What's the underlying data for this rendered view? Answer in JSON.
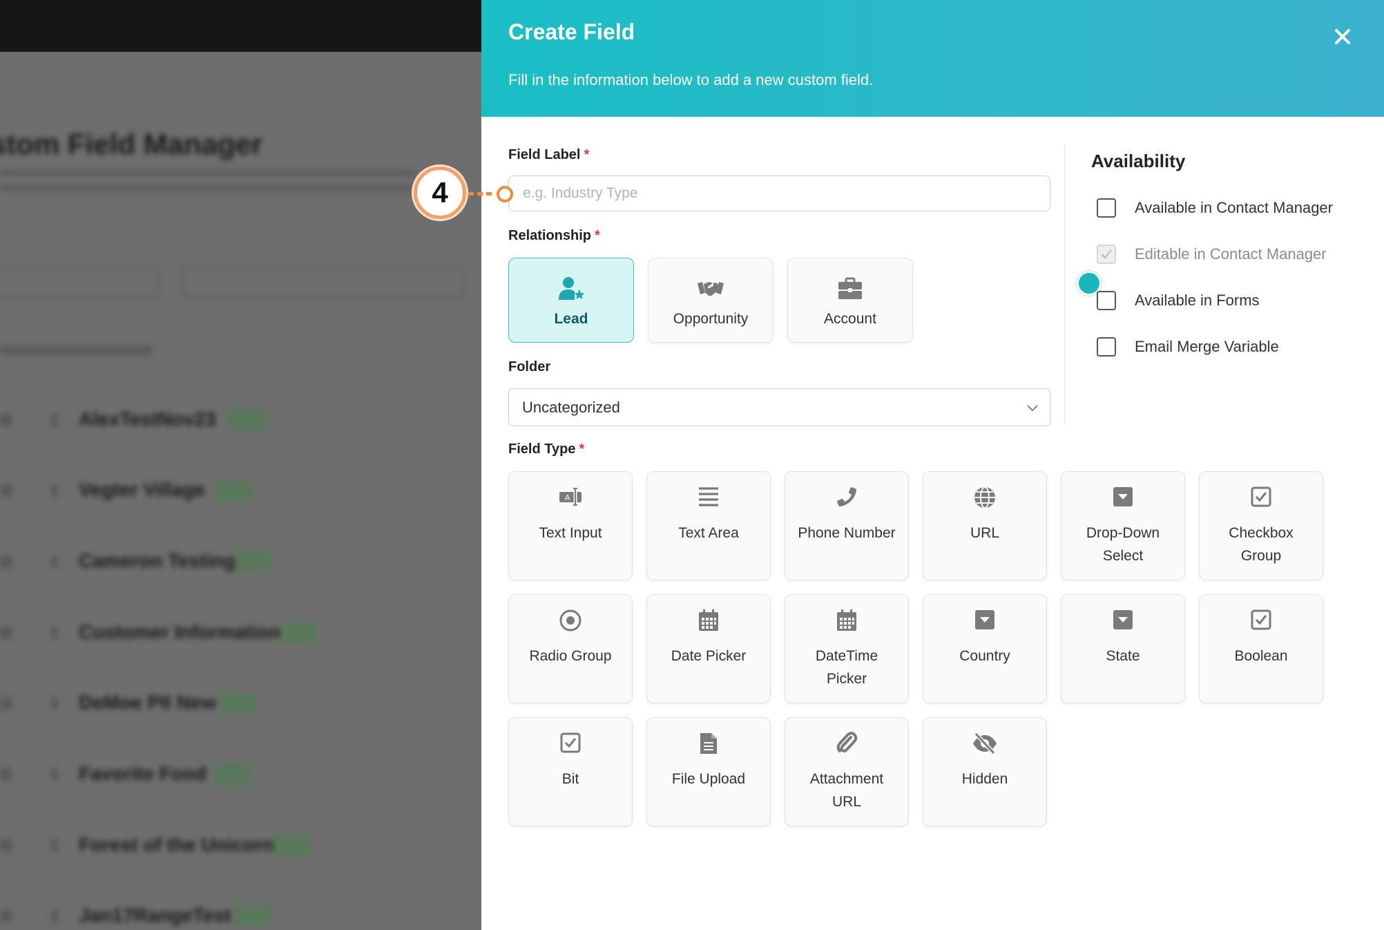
{
  "background": {
    "title": "stom Field Manager",
    "rows": [
      {
        "name": "AlexTestNov23"
      },
      {
        "name": "Vegter Village"
      },
      {
        "name": "Cameron Testing"
      },
      {
        "name": "Customer Information"
      },
      {
        "name": "DeMoe PII New"
      },
      {
        "name": "Favorite Food"
      },
      {
        "name": "Forest of the Unicorn"
      },
      {
        "name": "Jan17RangeTest"
      }
    ]
  },
  "panel": {
    "title": "Create Field",
    "subtitle": "Fill in the information below to add a new custom field.",
    "close_icon": "close-icon",
    "accent_color": "#1ab6bb"
  },
  "field_label": {
    "label": "Field Label",
    "required_mark": "*",
    "placeholder": "e.g. Industry Type",
    "value": ""
  },
  "relationship": {
    "label": "Relationship",
    "required_mark": "*",
    "selected": "Lead",
    "options": [
      {
        "label": "Lead",
        "icon": "user-star-icon"
      },
      {
        "label": "Opportunity",
        "icon": "handshake-icon"
      },
      {
        "label": "Account",
        "icon": "briefcase-icon"
      }
    ]
  },
  "folder": {
    "label": "Folder",
    "value": "Uncategorized",
    "icon": "chevron-down-icon"
  },
  "availability": {
    "title": "Availability",
    "options": [
      {
        "label": "Available in Contact Manager",
        "checked": false,
        "disabled": false
      },
      {
        "label": "Editable in Contact Manager",
        "checked": true,
        "disabled": true
      },
      {
        "label": "Available in Forms",
        "checked": false,
        "disabled": false
      },
      {
        "label": "Email Merge Variable",
        "checked": false,
        "disabled": false
      }
    ]
  },
  "field_type": {
    "label": "Field Type",
    "required_mark": "*",
    "types": [
      {
        "line1": "Text Input",
        "line2": "",
        "icon": "text-input-icon"
      },
      {
        "line1": "Text Area",
        "line2": "",
        "icon": "text-area-icon"
      },
      {
        "line1": "Phone Number",
        "line2": "",
        "icon": "phone-icon"
      },
      {
        "line1": "URL",
        "line2": "",
        "icon": "globe-icon"
      },
      {
        "line1": "Drop-Down",
        "line2": "Select",
        "icon": "dropdown-icon"
      },
      {
        "line1": "Checkbox",
        "line2": "Group",
        "icon": "checkbox-icon"
      },
      {
        "line1": "Radio Group",
        "line2": "",
        "icon": "radio-icon"
      },
      {
        "line1": "Date Picker",
        "line2": "",
        "icon": "calendar-icon"
      },
      {
        "line1": "DateTime",
        "line2": "Picker",
        "icon": "calendar-icon"
      },
      {
        "line1": "Country",
        "line2": "",
        "icon": "dropdown-icon"
      },
      {
        "line1": "State",
        "line2": "",
        "icon": "dropdown-icon"
      },
      {
        "line1": "Boolean",
        "line2": "",
        "icon": "checkbox-icon"
      },
      {
        "line1": "Bit",
        "line2": "",
        "icon": "checkbox-icon"
      },
      {
        "line1": "File Upload",
        "line2": "",
        "icon": "file-icon"
      },
      {
        "line1": "Attachment",
        "line2": "URL",
        "icon": "paperclip-icon"
      },
      {
        "line1": "Hidden",
        "line2": "",
        "icon": "eye-slash-icon"
      }
    ]
  },
  "callout": {
    "step": "4",
    "color": "#f08a3e"
  }
}
